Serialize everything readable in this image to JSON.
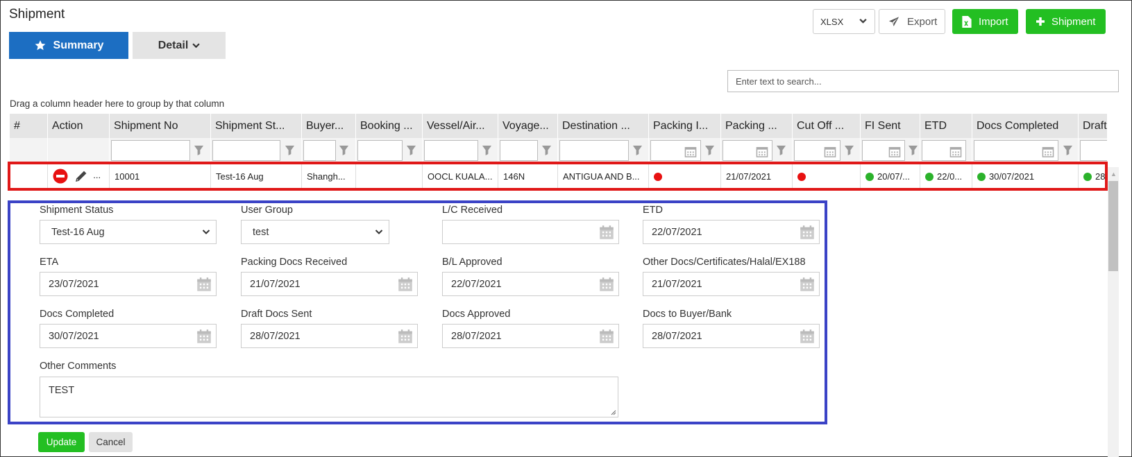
{
  "page": {
    "title": "Shipment"
  },
  "tabs": {
    "summary": "Summary",
    "detail": "Detail"
  },
  "toolbar": {
    "format_value": "XLSX",
    "export": "Export",
    "import": "Import",
    "add_shipment": "Shipment"
  },
  "search": {
    "placeholder": "Enter text to search..."
  },
  "grid": {
    "group_hint": "Drag a column header here to group by that column",
    "columns": [
      "#",
      "Action",
      "Shipment No",
      "Shipment St...",
      "Buyer...",
      "Booking ...",
      "Vessel/Air...",
      "Voyage...",
      "Destination ...",
      "Packing I...",
      "Packing ...",
      "Cut Off ...",
      "FI Sent",
      "ETD",
      "Docs Completed",
      "Draft"
    ],
    "row": {
      "index": "",
      "action_more": "...",
      "shipment_no": "10001",
      "shipment_status": "Test-16 Aug",
      "buyer": "Shangh...",
      "booking": "",
      "vessel": "OOCL KUALA...",
      "voyage": "146N",
      "destination": "ANTIGUA AND B...",
      "packing_i": "",
      "packing_i_status": "red",
      "packing_date": "21/07/2021",
      "cut_off": "",
      "cut_off_status": "red",
      "fi_sent": "20/07/...",
      "fi_sent_status": "green",
      "etd": "22/0...",
      "etd_status": "green",
      "docs_completed": "30/07/2021",
      "docs_completed_status": "green",
      "draft": "28/...",
      "draft_status": "green"
    }
  },
  "detail": {
    "shipment_status": {
      "label": "Shipment Status",
      "value": "Test-16 Aug"
    },
    "user_group": {
      "label": "User Group",
      "value": "test"
    },
    "lc_received": {
      "label": "L/C Received",
      "value": ""
    },
    "etd": {
      "label": "ETD",
      "value": "22/07/2021"
    },
    "eta": {
      "label": "ETA",
      "value": "23/07/2021"
    },
    "packing_docs_received": {
      "label": "Packing Docs Received",
      "value": "21/07/2021"
    },
    "bl_approved": {
      "label": "B/L Approved",
      "value": "22/07/2021"
    },
    "other_docs": {
      "label": "Other Docs/Certificates/Halal/EX188",
      "value": "21/07/2021"
    },
    "docs_completed": {
      "label": "Docs Completed",
      "value": "30/07/2021"
    },
    "draft_docs_sent": {
      "label": "Draft Docs Sent",
      "value": "28/07/2021"
    },
    "docs_approved": {
      "label": "Docs Approved",
      "value": "28/07/2021"
    },
    "docs_to_buyer": {
      "label": "Docs to Buyer/Bank",
      "value": "28/07/2021"
    },
    "other_comments": {
      "label": "Other Comments",
      "value": "TEST"
    }
  },
  "actions": {
    "update": "Update",
    "cancel": "Cancel"
  },
  "colors": {
    "primary": "#1c6ec2",
    "success": "#23bf22",
    "highlight_red": "#e01818",
    "highlight_blue": "#3b43c6",
    "status_red": "#e81111",
    "status_green": "#2bb22b"
  }
}
